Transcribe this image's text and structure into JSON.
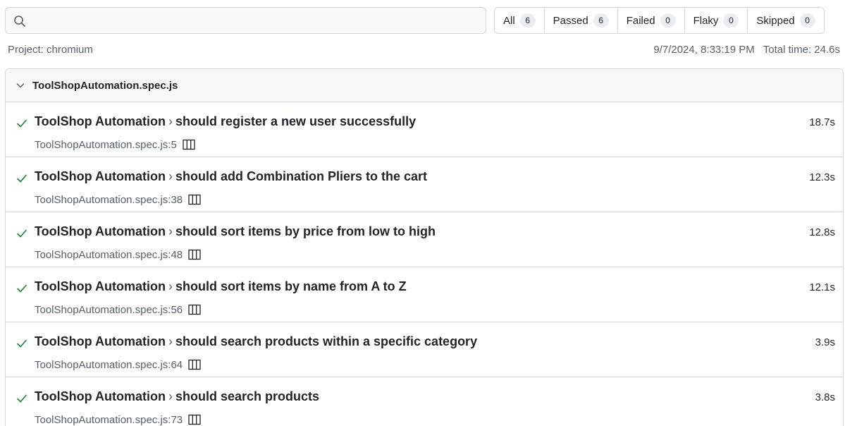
{
  "search": {
    "placeholder": "",
    "value": "",
    "icon": "search-icon"
  },
  "filters": [
    {
      "label": "All",
      "count": "6"
    },
    {
      "label": "Passed",
      "count": "6"
    },
    {
      "label": "Failed",
      "count": "0"
    },
    {
      "label": "Flaky",
      "count": "0"
    },
    {
      "label": "Skipped",
      "count": "0"
    }
  ],
  "meta": {
    "project": "Project: chromium",
    "timestamp": "9/7/2024, 8:33:19 PM",
    "total_time": "Total time: 24.6s"
  },
  "file": {
    "name": "ToolShopAutomation.spec.js",
    "tests": [
      {
        "suite": "ToolShop Automation",
        "separator": "›",
        "name": "should register a new user successfully",
        "duration": "18.7s",
        "location": "ToolShopAutomation.spec.js:5"
      },
      {
        "suite": "ToolShop Automation",
        "separator": "›",
        "name": "should add Combination Pliers to the cart",
        "duration": "12.3s",
        "location": "ToolShopAutomation.spec.js:38"
      },
      {
        "suite": "ToolShop Automation",
        "separator": "›",
        "name": "should sort items by price from low to high",
        "duration": "12.8s",
        "location": "ToolShopAutomation.spec.js:48"
      },
      {
        "suite": "ToolShop Automation",
        "separator": "›",
        "name": "should sort items by name from A to Z",
        "duration": "12.1s",
        "location": "ToolShopAutomation.spec.js:56"
      },
      {
        "suite": "ToolShop Automation",
        "separator": "›",
        "name": "should search products within a specific category",
        "duration": "3.9s",
        "location": "ToolShopAutomation.spec.js:64"
      },
      {
        "suite": "ToolShop Automation",
        "separator": "›",
        "name": "should search products",
        "duration": "3.8s",
        "location": "ToolShopAutomation.spec.js:73"
      }
    ]
  },
  "colors": {
    "pass": "#1a7f37",
    "border": "#d0d7de",
    "muted": "#57606a",
    "header_bg": "#f6f8fa"
  }
}
